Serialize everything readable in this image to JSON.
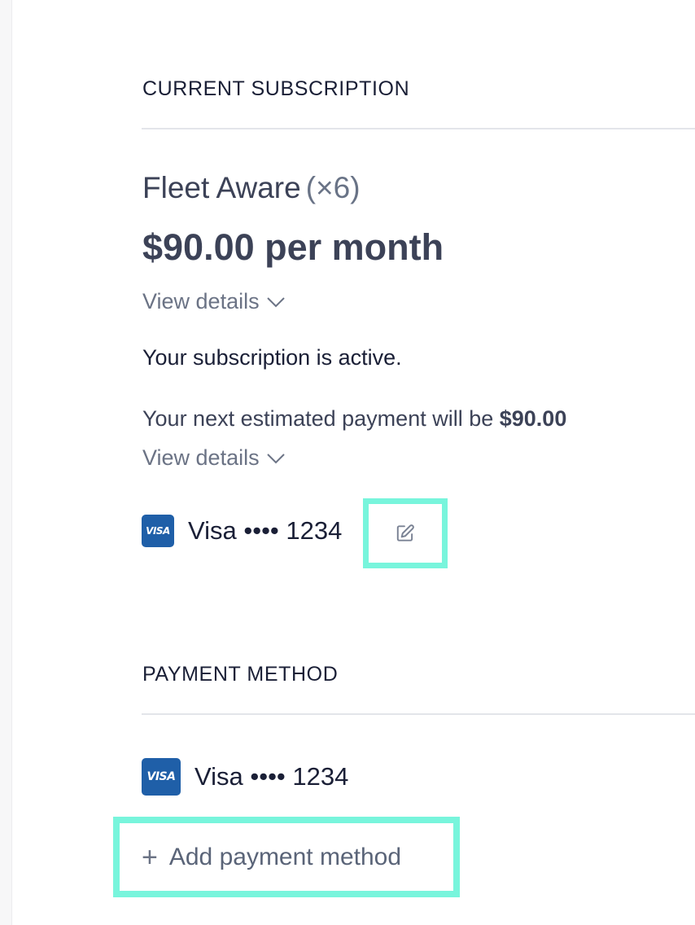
{
  "subscription": {
    "section_title": "CURRENT SUBSCRIPTION",
    "plan_name": "Fleet Aware",
    "plan_quantity": "(×6)",
    "price": "$90.00 per month",
    "view_details_label": "View details",
    "status": "Your subscription is active.",
    "next_payment_prefix": "Your next estimated payment will be ",
    "next_payment_amount": "$90.00",
    "view_details_label_2": "View details",
    "card": {
      "brand_badge": "VISA",
      "label": "Visa •••• 1234"
    }
  },
  "payment_method": {
    "section_title": "PAYMENT METHOD",
    "card": {
      "brand_badge": "VISA",
      "label": "Visa •••• 1234"
    },
    "add_button_plus": "+",
    "add_button_label": "Add payment method"
  },
  "colors": {
    "highlight": "#78f5dc",
    "visa_brand": "#1f5fa8"
  }
}
